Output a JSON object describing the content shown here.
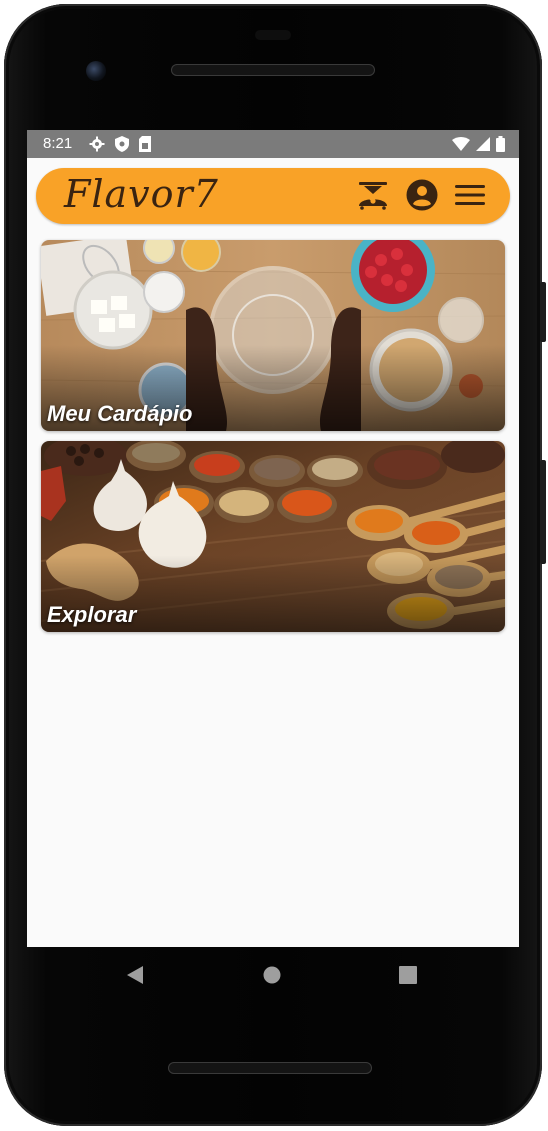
{
  "status": {
    "time": "8:21"
  },
  "app": {
    "logo": "Flavor7"
  },
  "cards": [
    {
      "label": "Meu Cardápio"
    },
    {
      "label": "Explorar"
    }
  ],
  "colors": {
    "accent": "#f9a227",
    "logo_text": "#3a2411",
    "statusbar": "#7b7b7b"
  },
  "icons": {
    "status_left": [
      "gear-icon",
      "shield-icon",
      "sim-card-icon"
    ],
    "status_right": [
      "wifi-icon",
      "signal-icon",
      "battery-icon"
    ],
    "appbar": [
      "recipe-scale-icon",
      "account-circle-icon",
      "menu-icon"
    ],
    "navigation": [
      "back-icon",
      "home-icon",
      "recents-icon"
    ]
  }
}
